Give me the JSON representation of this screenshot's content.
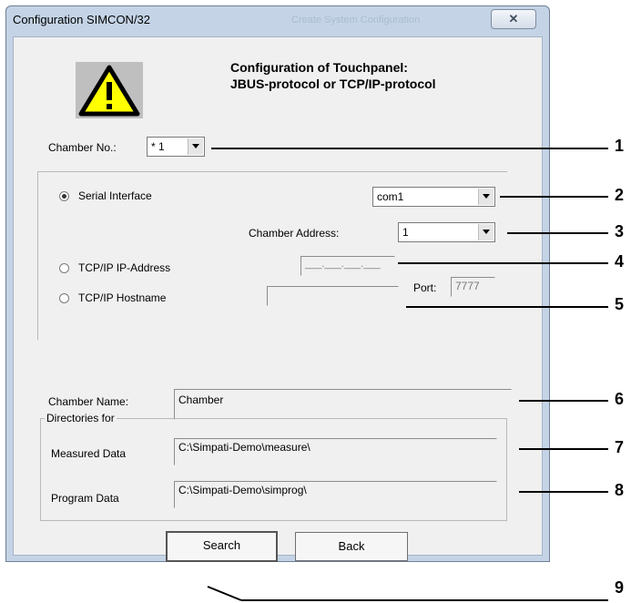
{
  "window": {
    "title": "Configuration SIMCON/32",
    "ghost_title": "Create System Configuration",
    "close_glyph": "✕"
  },
  "header": {
    "line1": "Configuration of Touchpanel:",
    "line2": "JBUS-protocol or TCP/IP-protocol",
    "icon": "warning-icon"
  },
  "chamber_no": {
    "label": "Chamber No.:",
    "value": "* 1"
  },
  "connection": {
    "serial_label": "Serial Interface",
    "serial_selected": true,
    "com_value": "com1",
    "address_label": "Chamber Address:",
    "address_value": "1",
    "ip_label": "TCP/IP IP-Address",
    "ip_value": "___.___.___.___",
    "hostname_label": "TCP/IP Hostname",
    "hostname_value": "",
    "port_label": "Port:",
    "port_value": "7777"
  },
  "chamber_name": {
    "label": "Chamber Name:",
    "value": "Chamber"
  },
  "directories": {
    "legend": "Directories for",
    "measured_label": "Measured Data",
    "measured_value": "C:\\Simpati-Demo\\measure\\",
    "program_label": "Program Data",
    "program_value": "C:\\Simpati-Demo\\simprog\\"
  },
  "buttons": {
    "search": "Search",
    "back": "Back"
  },
  "callouts": [
    "1",
    "2",
    "3",
    "4",
    "5",
    "6",
    "7",
    "8",
    "9"
  ],
  "colors": {
    "warning_yellow": "#ffff00",
    "window_frame": "#c4d4e6",
    "dialog_bg": "#f0f0f0"
  }
}
